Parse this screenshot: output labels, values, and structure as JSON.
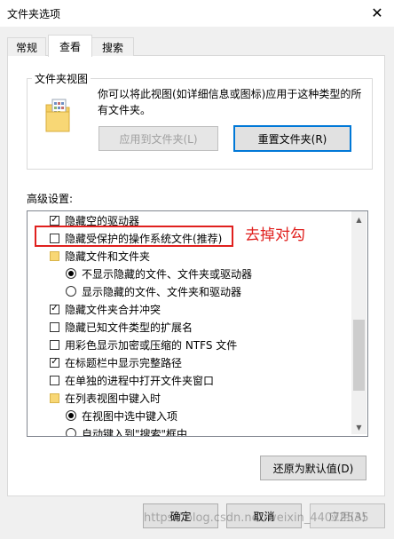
{
  "window": {
    "title": "文件夹选项",
    "close_glyph": "✕"
  },
  "tabs": [
    {
      "label": "常规"
    },
    {
      "label": "查看"
    },
    {
      "label": "搜索"
    }
  ],
  "folder_view": {
    "legend": "文件夹视图",
    "description": "你可以将此视图(如详细信息或图标)应用于这种类型的所有文件夹。",
    "apply_button": "应用到文件夹(L)",
    "reset_button": "重置文件夹(R)"
  },
  "advanced": {
    "label": "高级设置:",
    "items": [
      {
        "type": "checkbox",
        "checked": true,
        "label": "隐藏空的驱动器"
      },
      {
        "type": "checkbox",
        "checked": false,
        "label": "隐藏受保护的操作系统文件(推荐)"
      },
      {
        "type": "folder",
        "label": "隐藏文件和文件夹"
      },
      {
        "type": "radio",
        "checked": true,
        "label": "不显示隐藏的文件、文件夹或驱动器"
      },
      {
        "type": "radio",
        "checked": false,
        "label": "显示隐藏的文件、文件夹和驱动器"
      },
      {
        "type": "checkbox",
        "checked": true,
        "label": "隐藏文件夹合并冲突"
      },
      {
        "type": "checkbox",
        "checked": false,
        "label": "隐藏已知文件类型的扩展名"
      },
      {
        "type": "checkbox",
        "checked": false,
        "label": "用彩色显示加密或压缩的 NTFS 文件"
      },
      {
        "type": "checkbox",
        "checked": true,
        "label": "在标题栏中显示完整路径"
      },
      {
        "type": "checkbox",
        "checked": false,
        "label": "在单独的进程中打开文件夹窗口"
      },
      {
        "type": "folder",
        "label": "在列表视图中键入时"
      },
      {
        "type": "radio",
        "checked": true,
        "label": "在视图中选中键入项"
      },
      {
        "type": "radio",
        "checked": false,
        "label": "自动键入到\"搜索\"框中"
      }
    ],
    "restore_button": "还原为默认值(D)"
  },
  "annotation": {
    "text": "去掉对勾",
    "color": "#e0201e"
  },
  "footer": {
    "ok": "确定",
    "cancel": "取消",
    "apply": "应用(A)"
  },
  "watermark": "https://blog.csdn.net/weixin_44072535"
}
